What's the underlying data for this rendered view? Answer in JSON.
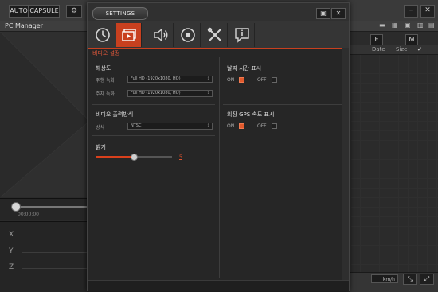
{
  "app": {
    "mode_buttons": [
      "AUTO",
      "CAPSULE"
    ],
    "section_title": "PC Manager",
    "timecode": "00:00:00",
    "axes": [
      "X",
      "Y",
      "Z"
    ],
    "file_list": {
      "headers": {
        "e": "E",
        "m": "M",
        "date": "Date",
        "size": "Size"
      }
    },
    "speed_unit": "km/h",
    "window_buttons": {
      "minimize": "–",
      "close": "✕"
    }
  },
  "settings": {
    "title": "SETTINGS",
    "tabs": [
      "clock",
      "video",
      "sound",
      "record",
      "tools",
      "info"
    ],
    "active_tab": "video",
    "subtitle": "비디오 설정",
    "resolution": {
      "heading": "해상도",
      "driving_label": "주행 녹화",
      "driving_value": "Full HD (1920x1080, HQ)",
      "parking_label": "주차 녹화",
      "parking_value": "Full HD (1920x1080, HQ)"
    },
    "video_output": {
      "heading": "비디오 출력방식",
      "mode_label": "방식",
      "mode_value": "NTSC"
    },
    "brightness": {
      "heading": "밝기",
      "value": "5",
      "level": 0.5
    },
    "datetime": {
      "heading": "날짜 시간 표시",
      "on_label": "ON",
      "off_label": "OFF",
      "state": "on"
    },
    "gps_speed": {
      "heading": "외장 GPS 속도 표시",
      "on_label": "ON",
      "off_label": "OFF",
      "state": "on"
    },
    "colors": {
      "accent": "#c8401f",
      "checkbox_on": "#e25a2d"
    }
  }
}
